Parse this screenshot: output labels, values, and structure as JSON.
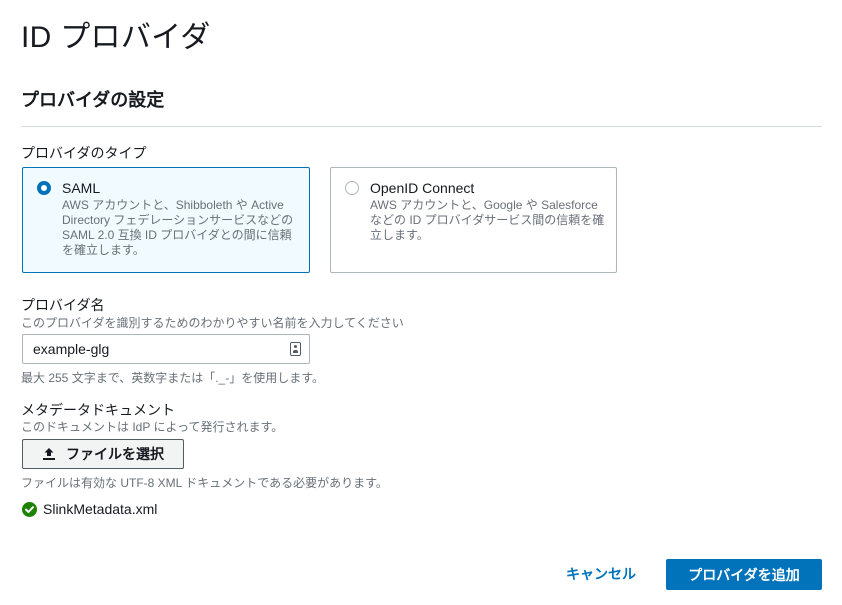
{
  "page": {
    "title": "ID プロバイダ"
  },
  "section": {
    "title": "プロバイダの設定"
  },
  "provider_type": {
    "label": "プロバイダのタイプ",
    "options": [
      {
        "title": "SAML",
        "description": "AWS アカウントと、Shibboleth や Active Directory フェデレーションサービスなどの SAML 2.0 互換 ID プロバイダとの間に信頼を確立します。",
        "selected": true
      },
      {
        "title": "OpenID Connect",
        "description": "AWS アカウントと、Google や Salesforce などの ID プロバイダサービス間の信頼を確立します。",
        "selected": false
      }
    ]
  },
  "provider_name": {
    "label": "プロバイダ名",
    "description": "このプロバイダを識別するためのわかりやすい名前を入力してください",
    "value": "example-glg",
    "hint": "最大 255 文字まで、英数字または「._-」を使用します。"
  },
  "metadata": {
    "label": "メタデータドキュメント",
    "description": "このドキュメントは IdP によって発行されます。",
    "button_label": "ファイルを選択",
    "hint": "ファイルは有効な UTF-8 XML ドキュメントである必要があります。",
    "uploaded_file": "SlinkMetadata.xml"
  },
  "actions": {
    "cancel_label": "キャンセル",
    "submit_label": "プロバイダを追加"
  },
  "colors": {
    "accent": "#0073bb",
    "success": "#1d8102",
    "selected_tile_bg": "#f1faff"
  }
}
